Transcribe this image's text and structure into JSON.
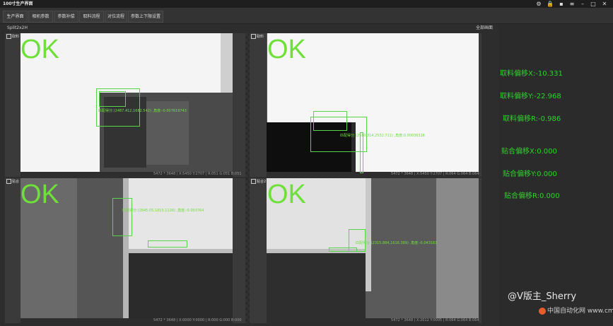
{
  "window": {
    "title": "100寸生产界面"
  },
  "tabs": [
    "生产界面",
    "相机参数",
    "参数补偿",
    "取料流程",
    "对位流程",
    "参数上下限设置"
  ],
  "view": {
    "split": "Split2x2H",
    "fullscreen": "全部画面"
  },
  "panes": [
    {
      "label": "取料",
      "result": "OK",
      "match": "匹配得分:(2487.412,1682.542) ,角度:-0.007619743",
      "status": "5472 * 3648  |  X:5450  Y:2707  |  R:051  G:051  B:051"
    },
    {
      "label": "取料",
      "result": "OK",
      "match": "匹配得分:(2510.314,2552.711) ,角度:0.00036316",
      "status": "5472 * 3648  |  X:5450  Y:2707  |  R:064  G:064  B:064"
    },
    {
      "label": "贴合",
      "result": "OK",
      "match": "匹配得分:(2645.05,1815.1126) ,角度:-0.003764",
      "status": "5472 * 3648  |  X:0000  Y:0000  |  R:000  G:000  B:000"
    },
    {
      "label": "贴合2",
      "result": "OK",
      "match": "匹配得分:(2315.884,1616.389) ,角度:-0.043163",
      "status": "5472 * 3648  |  X:2012  Y:0005  |  R:064  G:064  B:064"
    }
  ],
  "offsets": [
    "取料偏移X:-10.331",
    "取料偏移Y:-22.968",
    "取料偏移R:-0.986",
    "贴合偏移X:0.000",
    "贴合偏移Y:0.000",
    "贴合偏移R:0.000"
  ],
  "watermark": "@V版主_Sherry",
  "logo_text": "中国自动化网 www.cmn.com.cn",
  "colors": {
    "ok": "#6fe03a",
    "offset_text": "#2bd42b",
    "box": "#57d44a"
  }
}
